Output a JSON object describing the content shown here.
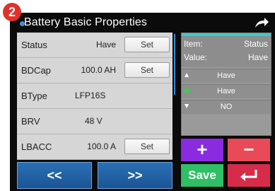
{
  "step_badge": "2",
  "header": {
    "title": "Battery Basic Properties",
    "return_icon": "return-arrow-icon"
  },
  "rows": [
    {
      "label": "Status",
      "value": "Have",
      "button": "Set"
    },
    {
      "label": "BDCap",
      "value": "100.0 AH",
      "button": "Set"
    },
    {
      "label": "BType",
      "value": "LFP16S",
      "button": ""
    },
    {
      "label": "BRV",
      "value": "48 V",
      "button": ""
    },
    {
      "label": "LBACC",
      "value": "100.0 A",
      "button": "Set"
    }
  ],
  "nav": {
    "prev": "<<",
    "next": ">>"
  },
  "editor": {
    "item_label": "Item:",
    "item_value": "Status",
    "value_label": "Value:",
    "value_value": "Have",
    "options": [
      {
        "text": "Have",
        "mark": "up-triangle-icon"
      },
      {
        "text": "Have",
        "mark": "check-icon"
      },
      {
        "text": "NO",
        "mark": "down-triangle-icon"
      }
    ]
  },
  "actions": {
    "plus": "+",
    "minus": "−",
    "save": "Save",
    "back_icon": "enter-return-icon"
  },
  "colors": {
    "accent_blue": "#1b5594",
    "plus_purple": "#8a2be2",
    "minus_red": "#e84b57",
    "save_green": "#2fbf66",
    "back_red": "#d62c4a",
    "badge_red": "#e0312a"
  }
}
